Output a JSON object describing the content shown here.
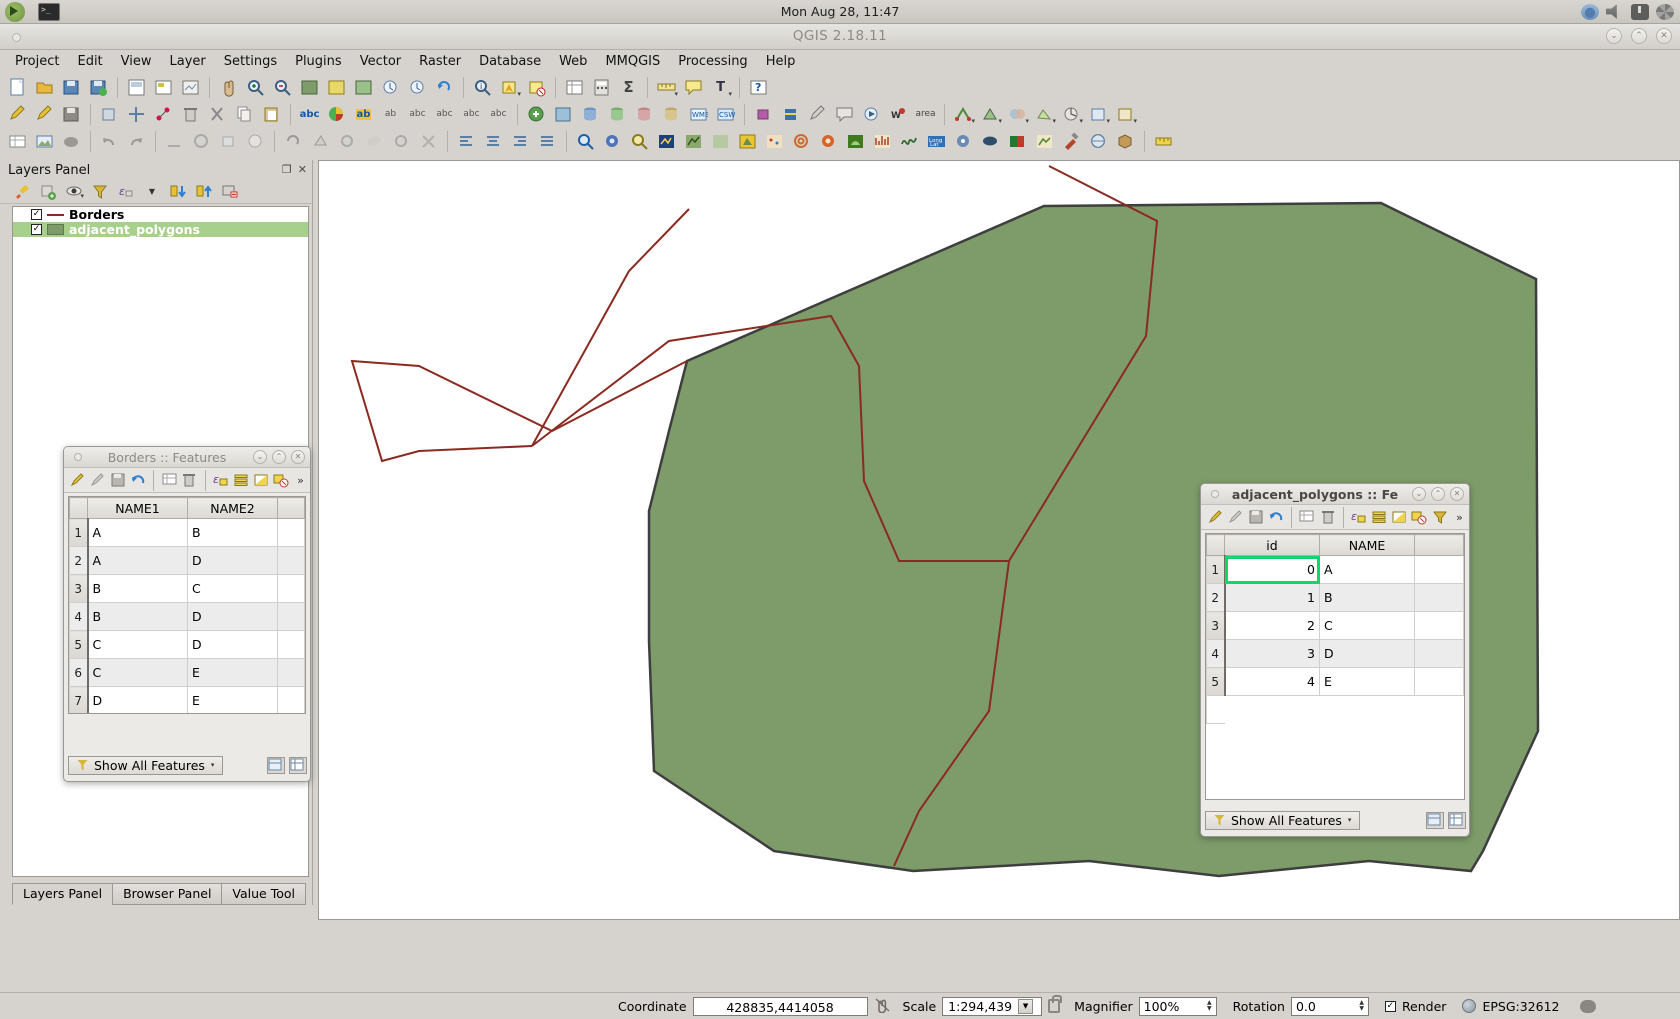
{
  "system": {
    "clock": "Mon Aug 28, 11:47",
    "launcher_icons": [
      "qgis-logo-icon",
      "terminal-icon"
    ],
    "tray_icons": [
      "network-icon",
      "volume-icon",
      "power-icon",
      "settings-icon"
    ]
  },
  "window": {
    "title": "QGIS 2.18.11",
    "buttons": [
      "minimize",
      "maximize",
      "close"
    ]
  },
  "menu": [
    "Project",
    "Edit",
    "View",
    "Layer",
    "Settings",
    "Plugins",
    "Vector",
    "Raster",
    "Database",
    "Web",
    "MMQGIS",
    "Processing",
    "Help"
  ],
  "layers_panel": {
    "title": "Layers Panel",
    "toolbar_icons": [
      "style-manager-icon",
      "add-group-icon",
      "manage-visibility-icon",
      "filter-legend-icon",
      "expression-filter-icon",
      "expand-all-icon",
      "collapse-all-icon",
      "remove-layer-icon"
    ],
    "layers": [
      {
        "name": "Borders",
        "checked": true,
        "selected": false,
        "symbol": "line",
        "color": "#8b2a20"
      },
      {
        "name": "adjacent_polygons",
        "checked": true,
        "selected": true,
        "symbol": "polygon",
        "color": "#7d9c6a"
      }
    ],
    "tabs": [
      {
        "label": "Layers Panel",
        "active": true
      },
      {
        "label": "Browser Panel",
        "active": false
      },
      {
        "label": "Value Tool",
        "active": false
      }
    ]
  },
  "borders_table": {
    "title": "Borders :: Features",
    "active": false,
    "toolbar_icons": [
      "toggle-editing-icon",
      "edit-mode-icon",
      "save-edits-icon",
      "reload-icon",
      "new-field-icon",
      "delete-field-icon",
      "expression-select-icon",
      "select-all-icon",
      "invert-selection-icon",
      "deselect-all-icon",
      "more-icon"
    ],
    "columns": [
      "NAME1",
      "NAME2"
    ],
    "rows": [
      {
        "n": "1",
        "NAME1": "A",
        "NAME2": "B"
      },
      {
        "n": "2",
        "NAME1": "A",
        "NAME2": "D"
      },
      {
        "n": "3",
        "NAME1": "B",
        "NAME2": "C"
      },
      {
        "n": "4",
        "NAME1": "B",
        "NAME2": "D"
      },
      {
        "n": "5",
        "NAME1": "C",
        "NAME2": "D"
      },
      {
        "n": "6",
        "NAME1": "C",
        "NAME2": "E"
      },
      {
        "n": "7",
        "NAME1": "D",
        "NAME2": "E"
      }
    ],
    "footer": {
      "show_all_label": "Show All Features"
    }
  },
  "polygons_table": {
    "title": "adjacent_polygons :: Fe",
    "active": true,
    "columns": [
      "id",
      "NAME"
    ],
    "rows": [
      {
        "n": "1",
        "id": "0",
        "NAME": "A",
        "selected": true
      },
      {
        "n": "2",
        "id": "1",
        "NAME": "B",
        "selected": false
      },
      {
        "n": "3",
        "id": "2",
        "NAME": "C",
        "selected": false
      },
      {
        "n": "4",
        "id": "3",
        "NAME": "D",
        "selected": false
      },
      {
        "n": "5",
        "id": "4",
        "NAME": "E",
        "selected": false
      }
    ],
    "footer": {
      "show_all_label": "Show All Features"
    },
    "selection_color": "#14d46a"
  },
  "map": {
    "fill_color": "#7d9c6a",
    "border_color": "#8b2a20",
    "outline_color": "#3e3e3e"
  },
  "status": {
    "coordinate_label": "Coordinate",
    "coordinate_value": "428835,4414058",
    "scale_label": "Scale",
    "scale_value": "1:294,439",
    "magnifier_label": "Magnifier",
    "magnifier_value": "100%",
    "rotation_label": "Rotation",
    "rotation_value": "0.0",
    "render_label": "Render",
    "render_checked": true,
    "crs_label": "EPSG:32612"
  }
}
